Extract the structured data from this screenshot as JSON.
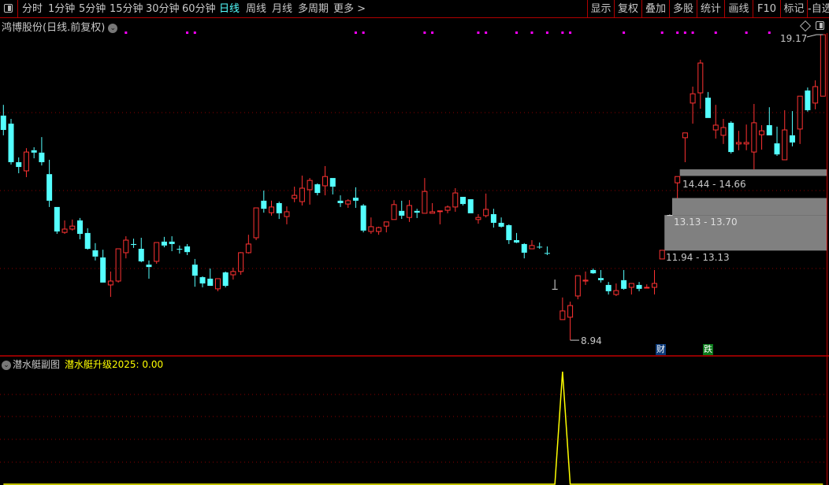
{
  "toolbar": {
    "periods": [
      "分时",
      "1分钟",
      "5分钟",
      "15分钟",
      "30分钟",
      "60分钟",
      "日线",
      "周线",
      "月线",
      "多周期",
      "更多 >"
    ],
    "active_period": "日线",
    "right_buttons": [
      "显示",
      "复权",
      "叠加",
      "多股",
      "统计",
      "画线",
      "F10",
      "标记",
      "-自选"
    ]
  },
  "main": {
    "title": "鸿博股份(日线.前复权)",
    "high_label": "19.17",
    "low_label": "8.94",
    "gaps": [
      {
        "label": "14.44 - 14.66",
        "low": 14.44,
        "high": 14.66,
        "start_index": 88
      },
      {
        "label": "13.13 - 13.70",
        "low": 13.13,
        "high": 13.7,
        "start_index": 87
      },
      {
        "label": "11.94 - 13.13",
        "low": 11.94,
        "high": 13.13,
        "start_index": 86
      }
    ],
    "event_tags": [
      {
        "text": "财",
        "index": 86,
        "color": "#0a3a7a"
      },
      {
        "text": "跌",
        "index": 92,
        "color": "#0a7a1a"
      }
    ],
    "signal_marker_indices": [
      16,
      24,
      25,
      46,
      47,
      55,
      56,
      62,
      63,
      67,
      69,
      71,
      73,
      74,
      81,
      86,
      88,
      89,
      90,
      93,
      97,
      100
    ],
    "colors": {
      "up": "#ff3232",
      "down": "#54ffff",
      "marker": "#ff00ff",
      "grid": "#8b0000",
      "indicator": "#ffff00"
    }
  },
  "chart_data": [
    {
      "type": "candlestick",
      "ohlc": [
        [
          16.46,
          16.82,
          15.8,
          15.98
        ],
        [
          16.19,
          16.35,
          14.82,
          14.9
        ],
        [
          14.9,
          15.06,
          14.53,
          14.74
        ],
        [
          14.61,
          15.37,
          14.4,
          15.24
        ],
        [
          15.3,
          15.4,
          15.03,
          15.22
        ],
        [
          15.22,
          15.74,
          14.79,
          14.9
        ],
        [
          14.5,
          14.98,
          13.4,
          13.61
        ],
        [
          13.4,
          13.4,
          12.5,
          12.58
        ],
        [
          12.55,
          12.95,
          12.5,
          12.66
        ],
        [
          12.66,
          12.98,
          12.61,
          12.76
        ],
        [
          12.95,
          13.03,
          12.32,
          12.5
        ],
        [
          12.53,
          12.69,
          11.97,
          12.0
        ],
        [
          11.95,
          12.19,
          11.61,
          11.74
        ],
        [
          11.71,
          11.97,
          10.87,
          10.87
        ],
        [
          10.79,
          11.24,
          10.39,
          10.92
        ],
        [
          10.92,
          12.0,
          10.87,
          12.0
        ],
        [
          11.87,
          12.42,
          11.68,
          12.29
        ],
        [
          12.16,
          12.34,
          12.03,
          12.13
        ],
        [
          12.0,
          12.37,
          11.55,
          11.58
        ],
        [
          11.47,
          11.61,
          11.0,
          11.39
        ],
        [
          11.58,
          12.21,
          11.5,
          12.21
        ],
        [
          12.24,
          12.4,
          12.05,
          12.11
        ],
        [
          12.24,
          12.42,
          11.92,
          12.16
        ],
        [
          12.0,
          12.11,
          11.84,
          11.99
        ],
        [
          12.08,
          12.16,
          11.79,
          11.89
        ],
        [
          11.47,
          11.66,
          10.73,
          11.1
        ],
        [
          11.05,
          11.08,
          10.71,
          10.84
        ],
        [
          11.0,
          11.34,
          10.76,
          10.76
        ],
        [
          10.66,
          11.0,
          10.58,
          11.0
        ],
        [
          11.21,
          11.24,
          10.71,
          10.76
        ],
        [
          11.13,
          11.37,
          10.97,
          11.24
        ],
        [
          11.24,
          11.89,
          11.13,
          11.87
        ],
        [
          11.87,
          12.47,
          11.84,
          12.16
        ],
        [
          12.37,
          13.37,
          12.29,
          13.37
        ],
        [
          13.61,
          13.95,
          13.21,
          13.34
        ],
        [
          13.21,
          13.61,
          13.11,
          13.4
        ],
        [
          13.53,
          13.58,
          13.0,
          13.19
        ],
        [
          13.08,
          13.42,
          12.82,
          13.24
        ],
        [
          13.69,
          14.08,
          13.56,
          13.79
        ],
        [
          13.58,
          14.45,
          13.45,
          14.03
        ],
        [
          13.98,
          14.37,
          13.48,
          14.29
        ],
        [
          14.16,
          14.19,
          13.79,
          13.87
        ],
        [
          14.11,
          14.77,
          13.79,
          14.42
        ],
        [
          14.37,
          14.37,
          13.82,
          14.08
        ],
        [
          13.61,
          13.79,
          13.4,
          13.53
        ],
        [
          13.5,
          13.66,
          13.37,
          13.61
        ],
        [
          13.71,
          14.06,
          13.37,
          13.61
        ],
        [
          13.45,
          13.5,
          12.55,
          12.61
        ],
        [
          12.58,
          13.05,
          12.5,
          12.74
        ],
        [
          12.58,
          12.74,
          12.47,
          12.71
        ],
        [
          12.76,
          12.9,
          12.55,
          12.9
        ],
        [
          12.98,
          13.63,
          12.98,
          13.48
        ],
        [
          13.27,
          13.61,
          13.0,
          13.11
        ],
        [
          13.05,
          13.63,
          12.9,
          13.45
        ],
        [
          13.27,
          13.34,
          13.03,
          13.21
        ],
        [
          13.19,
          14.37,
          13.19,
          13.92
        ],
        [
          13.19,
          13.53,
          13.19,
          13.24
        ],
        [
          13.26,
          13.27,
          12.82,
          13.27
        ],
        [
          13.29,
          13.45,
          13.19,
          13.4
        ],
        [
          13.4,
          14.03,
          13.24,
          13.87
        ],
        [
          13.74,
          13.74,
          13.45,
          13.5
        ],
        [
          13.66,
          13.66,
          13.19,
          13.19
        ],
        [
          12.98,
          13.16,
          12.84,
          13.05
        ],
        [
          13.11,
          13.85,
          13.05,
          13.32
        ],
        [
          13.16,
          13.34,
          12.71,
          12.87
        ],
        [
          12.87,
          13.05,
          12.71,
          12.74
        ],
        [
          12.79,
          12.82,
          12.16,
          12.29
        ],
        [
          12.29,
          12.53,
          12.19,
          12.21
        ],
        [
          12.16,
          12.19,
          11.68,
          11.87
        ],
        [
          12.0,
          12.29,
          12.0,
          12.11
        ],
        [
          12.07,
          12.21,
          12.0,
          12.05
        ],
        [
          11.86,
          12.08,
          11.79,
          11.84
        ],
        [
          10.66,
          10.97,
          10.66,
          10.66
        ],
        [
          9.63,
          10.37,
          9.63,
          9.92
        ],
        [
          9.71,
          10.23,
          8.94,
          10.1
        ],
        [
          10.42,
          11.1,
          10.31,
          11.1
        ],
        [
          10.92,
          11.24,
          10.79,
          10.95
        ],
        [
          11.29,
          11.34,
          11.16,
          11.18
        ],
        [
          11.02,
          11.29,
          10.87,
          10.95
        ],
        [
          10.79,
          10.89,
          10.47,
          10.58
        ],
        [
          10.47,
          10.84,
          10.42,
          10.6
        ],
        [
          10.95,
          11.29,
          10.63,
          10.66
        ],
        [
          10.71,
          10.84,
          10.47,
          10.84
        ],
        [
          10.79,
          10.89,
          10.58,
          10.66
        ],
        [
          10.7,
          10.81,
          10.7,
          10.71
        ],
        [
          10.71,
          11.29,
          10.47,
          10.84
        ],
        [
          11.66,
          11.95,
          11.66,
          11.95
        ],
        [
          13.13,
          13.15,
          13.13,
          13.13
        ],
        [
          14.21,
          14.42,
          13.69,
          14.42
        ],
        [
          15.72,
          15.88,
          14.9,
          15.88
        ],
        [
          16.88,
          17.43,
          16.19,
          17.19
        ],
        [
          17.22,
          18.33,
          16.69,
          18.22
        ],
        [
          17.06,
          17.25,
          16.38,
          16.38
        ],
        [
          15.98,
          16.82,
          15.69,
          16.14
        ],
        [
          15.8,
          16.35,
          15.51,
          16.06
        ],
        [
          16.22,
          16.27,
          15.19,
          15.24
        ],
        [
          15.51,
          15.95,
          15.3,
          15.56
        ],
        [
          15.51,
          16.16,
          15.3,
          15.56
        ],
        [
          15.24,
          16.85,
          14.66,
          16.22
        ],
        [
          15.82,
          16.14,
          15.32,
          15.95
        ],
        [
          16.14,
          16.74,
          15.8,
          15.8
        ],
        [
          15.53,
          16.09,
          15.11,
          15.16
        ],
        [
          14.98,
          16.64,
          14.98,
          15.98
        ],
        [
          15.8,
          16.61,
          15.43,
          15.56
        ],
        [
          16.01,
          17.11,
          15.51,
          17.11
        ],
        [
          17.3,
          17.4,
          16.59,
          16.64
        ],
        [
          16.88,
          17.64,
          16.67,
          17.43
        ],
        [
          17.11,
          19.17,
          17.11,
          19.17
        ]
      ],
      "grid": true
    },
    {
      "type": "line",
      "name": "潜水艇升级2025",
      "nonzero": {
        "73": 1
      },
      "length": 108,
      "grid": true
    }
  ],
  "sub": {
    "title": "潜水艇副图",
    "indicator_label": "潜水艇升级2025: 0.00"
  }
}
